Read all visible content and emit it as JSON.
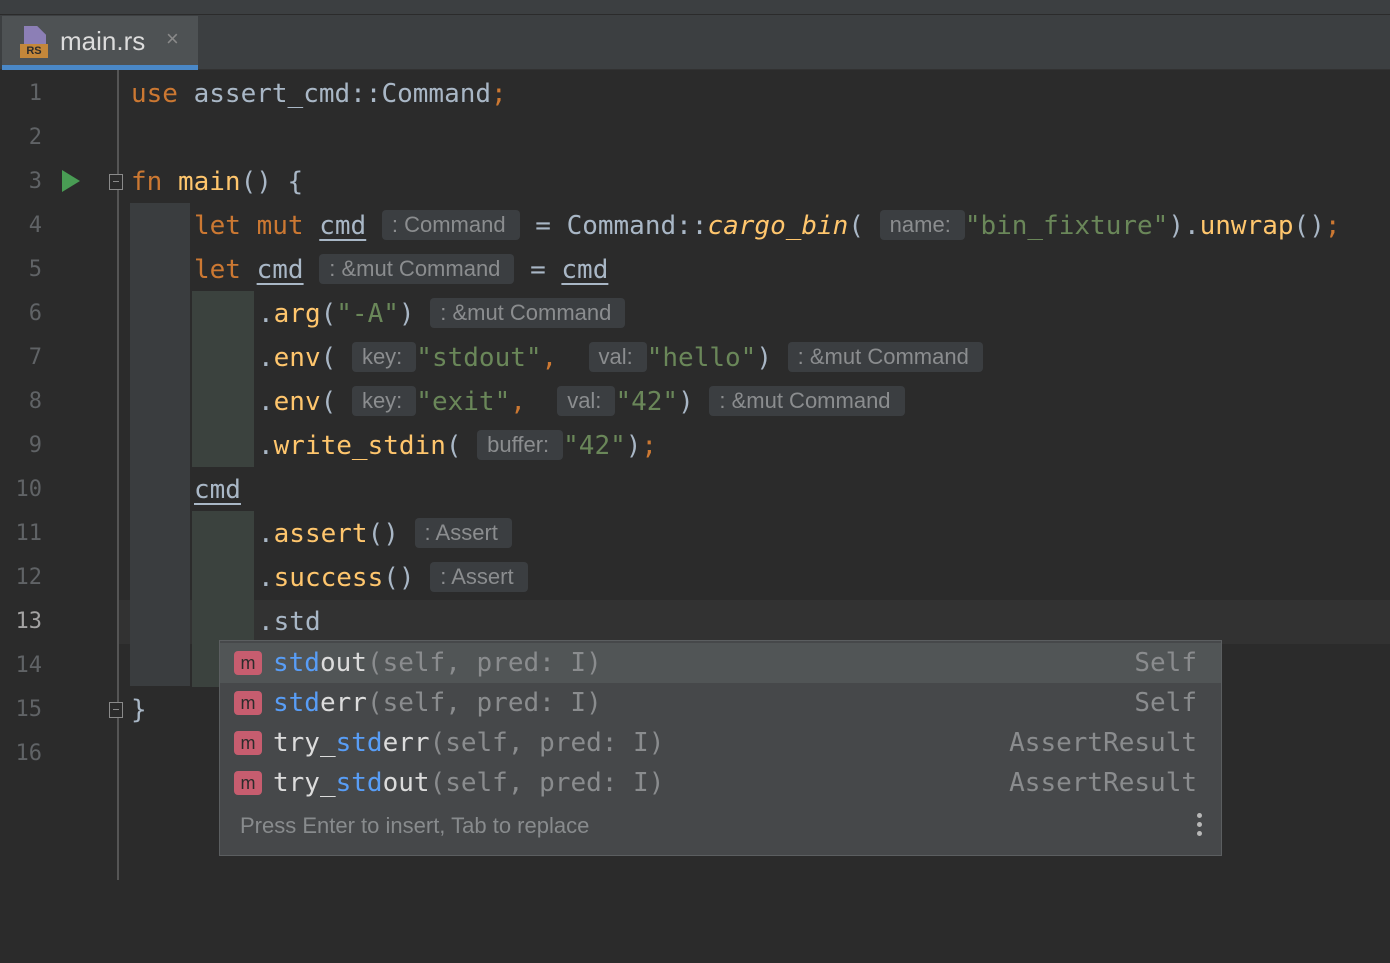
{
  "tab": {
    "filename": "main.rs",
    "icon_badge": "RS",
    "close_glyph": "×"
  },
  "lines": {
    "1": "1",
    "2": "2",
    "3": "3",
    "4": "4",
    "5": "5",
    "6": "6",
    "7": "7",
    "8": "8",
    "9": "9",
    "10": "10",
    "11": "11",
    "12": "12",
    "13": "13",
    "14": "14",
    "15": "15",
    "16": "16"
  },
  "code": {
    "use_kw": "use",
    "use_path": " assert_cmd::Command",
    "semicolon": ";",
    "fn_kw": "fn",
    "main_name": "main",
    "main_rest": "() {",
    "let_kw": "let",
    "mut_kw": "mut",
    "cmd": "cmd",
    "hint_command": ": Command",
    "eq": " = ",
    "command_path": "Command::",
    "cargo_bin": "cargo_bin",
    "open_paren": "(",
    "hint_name": "name:",
    "bin_fixture": "\"bin_fixture\"",
    "close_paren_dot": ").",
    "unwrap": "unwrap",
    "unwrap_rest": "()",
    "hint_mut_command": ": &mut Command",
    "dot": ".",
    "arg": "arg",
    "arg_str": "\"-A\"",
    "close_paren": ")",
    "env": "env",
    "hint_key": "key:",
    "stdout_str": "\"stdout\"",
    "comma": ",",
    "hint_val": "val:",
    "hello_str": "\"hello\"",
    "exit_str": "\"exit\"",
    "s42": "\"42\"",
    "write_stdin": "write_stdin",
    "hint_buffer": "buffer:",
    "assert": "assert",
    "parens": "()",
    "hint_assert": ": Assert",
    "success": "success",
    "std_typed": "std",
    "close_brace": "}"
  },
  "completion": {
    "items": [
      {
        "prefix": "",
        "match": "std",
        "rest": "out",
        "params": "(self, pred: I)",
        "type": "Self",
        "kind": "m"
      },
      {
        "prefix": "",
        "match": "std",
        "rest": "err",
        "params": "(self, pred: I)",
        "type": "Self",
        "kind": "m"
      },
      {
        "prefix": "try_",
        "match": "std",
        "rest": "err",
        "params": "(self, pred: I)",
        "type": "AssertResult",
        "kind": "m"
      },
      {
        "prefix": "try_",
        "match": "std",
        "rest": "out",
        "params": "(self, pred: I)",
        "type": "AssertResult",
        "kind": "m"
      }
    ],
    "footer": "Press Enter to insert, Tab to replace",
    "menu_icon": "more-vertical-icon"
  },
  "colors": {
    "background": "#2b2b2b",
    "keyword": "#cc7832",
    "function": "#ffc66d",
    "string": "#6a8759",
    "identifier": "#a9b7c6",
    "match_highlight": "#589df6",
    "method_badge": "#c75d6f",
    "tab_underline": "#4a88c7",
    "run_icon": "#499c54"
  }
}
